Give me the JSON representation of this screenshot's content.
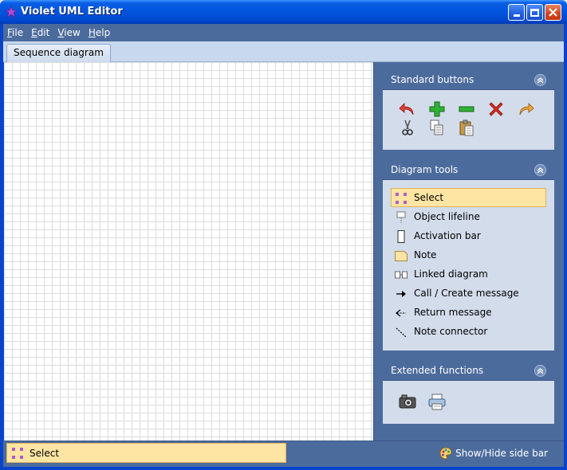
{
  "window": {
    "title": "Violet UML Editor"
  },
  "menu": {
    "items": [
      {
        "key": "F",
        "rest": "ile"
      },
      {
        "key": "E",
        "rest": "dit"
      },
      {
        "key": "V",
        "rest": "iew"
      },
      {
        "key": "H",
        "rest": "elp"
      }
    ]
  },
  "tabs": {
    "active": "Sequence diagram"
  },
  "sidebar": {
    "standard": {
      "title": "Standard buttons",
      "icons": [
        "undo-icon",
        "add-icon",
        "remove-icon",
        "delete-icon",
        "redo-icon",
        "cut-icon",
        "copy-icon",
        "paste-icon"
      ]
    },
    "tools": {
      "title": "Diagram tools",
      "items": [
        {
          "label": "Select",
          "icon": "select-icon"
        },
        {
          "label": "Object lifeline",
          "icon": "object-lifeline-icon"
        },
        {
          "label": "Activation bar",
          "icon": "activation-bar-icon"
        },
        {
          "label": "Note",
          "icon": "note-icon"
        },
        {
          "label": "Linked diagram",
          "icon": "linked-diagram-icon"
        },
        {
          "label": "Call / Create message",
          "icon": "call-message-icon"
        },
        {
          "label": "Return message",
          "icon": "return-message-icon"
        },
        {
          "label": "Note connector",
          "icon": "note-connector-icon"
        }
      ],
      "selected": "Select"
    },
    "extended": {
      "title": "Extended functions",
      "icons": [
        "camera-icon",
        "print-icon"
      ]
    }
  },
  "status": {
    "selected_tool": "Select",
    "toggle_label": "Show/Hide side bar"
  },
  "colors": {
    "title_bar": "#0253dd",
    "chrome": "#4c6b9d",
    "panel_bg": "#d3dcea",
    "selected_bg": "#ffe5a3",
    "grid_line": "#dcdcdc"
  }
}
